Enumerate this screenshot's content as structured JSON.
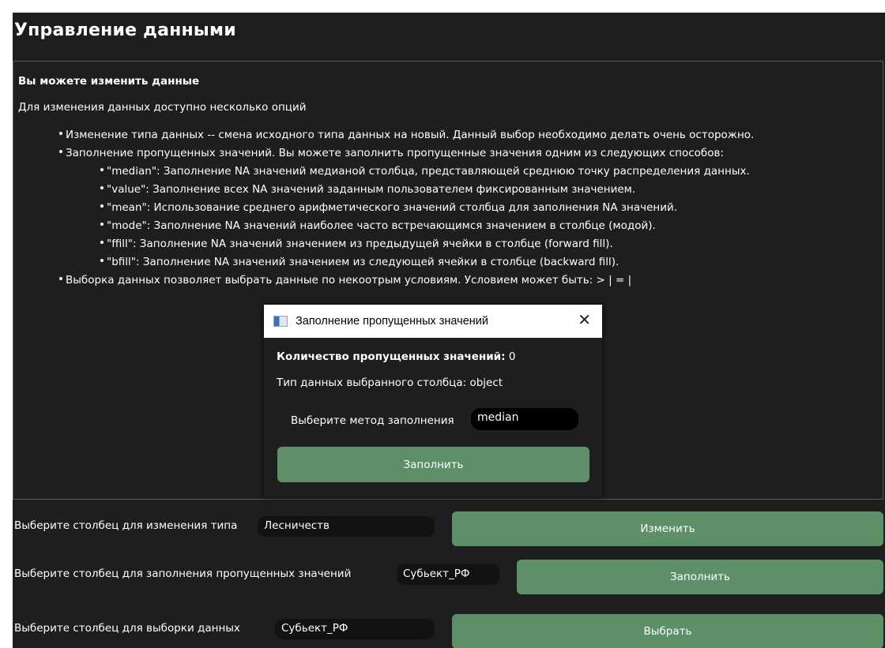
{
  "page": {
    "title": "Управление данными"
  },
  "info": {
    "heading": "Вы можете изменить данные",
    "intro": "Для изменения данных доступно несколько опций",
    "bullets": [
      "Изменение типа данных -- смена исходного типа данных на новый. Данный выбор необходимо делать очень осторожно.",
      "Заполнение пропущенных значений. Вы можете заполнить пропущенные значения одним из следующих способов:",
      "Выборка данных позволяет выбрать данные по некоотрым условиям. Условием может быть: > | = |"
    ],
    "sub_bullets": [
      "\"median\": Заполнение NA значений медианой столбца, представляющей среднюю точку распределения данных.",
      "\"value\": Заполнение всех NA значений заданным пользователем фиксированным значением.",
      "\"mean\": Использование среднего арифметического значений столбца для заполнения NA значений.",
      "\"mode\": Заполнение NA значений наиболее часто встречающимся значением в столбце (модой).",
      "\"ffill\": Заполнение NA значений значением из предыдущей ячейки в столбце (forward fill).",
      "\"bfill\": Заполнение NA значений значением из следующей ячейки в столбце (backward fill)."
    ]
  },
  "controls": {
    "type_change": {
      "label": "Выберите столбец для изменения типа",
      "value": "Лесничеств",
      "button": "Изменить"
    },
    "fill_missing": {
      "label": "Выберите столбец для заполнения пропущенных значений",
      "value": "Субьект_РФ",
      "button": "Заполнить"
    },
    "select_data": {
      "label": "Выберите столбец для выборки данных",
      "value": "Субьект_РФ",
      "button": "Выбрать"
    }
  },
  "dialog": {
    "title": "Заполнение пропущенных значений",
    "close_icon": "close-icon",
    "count_label": "Количество пропущенных значений:",
    "count_value": "0",
    "type_text": "Тип данных выбранного столбца: object",
    "method_label": "Выберите метод заполнения",
    "method_value": "median",
    "fill_button": "Заполнить"
  },
  "colors": {
    "background": "#1e1e1e",
    "accent_green": "#5d8f68",
    "input_bg": "#121212"
  }
}
